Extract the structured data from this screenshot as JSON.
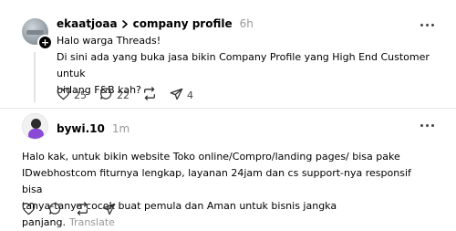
{
  "posts": [
    {
      "username": "ekaatjoaa",
      "topic": "company profile",
      "time": "6h",
      "text_line1": "Halo warga Threads!",
      "text_line2": "Di sini ada yang buka jasa bikin Company Profile yang High End Customer untuk",
      "text_line3": "bidang F&B kah?",
      "likes": "25",
      "replies": "22",
      "shares": "4"
    },
    {
      "username": "bywi.10",
      "time": "1m",
      "text_line1": "Halo kak, untuk bikin website Toko online/Compro/landing pages/ bisa pake",
      "text_line2": "IDwebhostcom fiturnya lengkap, layanan 24jam dan cs support-nya responsif bisa",
      "text_line3": "tanya-tanya cocok buat pemula dan Aman untuk bisnis jangka panjang.",
      "translate": "Translate"
    }
  ],
  "icons": {
    "like": "heart-icon",
    "reply": "comment-icon",
    "repost": "repost-icon",
    "share": "send-icon",
    "more": "more-horizontal-icon",
    "topic_separator": "chevron-right-icon",
    "follow_badge": "plus-icon"
  }
}
